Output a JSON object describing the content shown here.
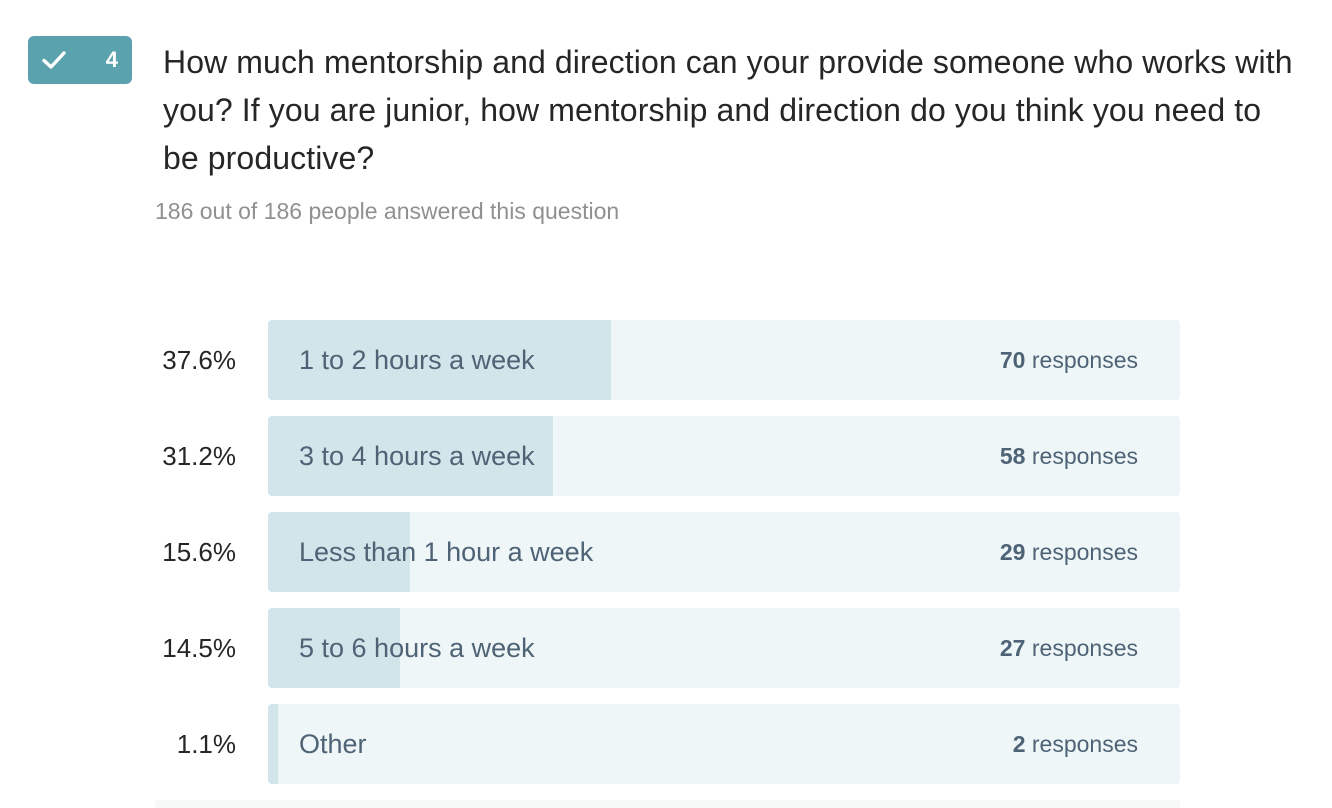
{
  "question": {
    "number": "4",
    "badge_icon": "check-icon",
    "badge_color": "#5aa2ad",
    "title": "How much mentorship and direction can your provide someone who works with you? If you are junior, how mentorship and direction do you think you need to be productive?",
    "answered_text": "186 out of 186 people answered this question"
  },
  "responses_word": "responses",
  "chart_data": {
    "type": "bar",
    "orientation": "horizontal",
    "categories": [
      "1 to 2 hours a week",
      "3 to 4 hours a week",
      "Less than 1 hour a week",
      "5 to 6 hours a week",
      "Other"
    ],
    "values": [
      70,
      58,
      29,
      27,
      2
    ],
    "percent_labels": [
      "37.6%",
      "31.2%",
      "15.6%",
      "14.5%",
      "1.1%"
    ],
    "percents": [
      37.6,
      31.2,
      15.6,
      14.5,
      1.1
    ],
    "count_labels": [
      "70",
      "58",
      "29",
      "27",
      "2"
    ],
    "xlim": [
      0,
      100
    ],
    "title": "",
    "xlabel": "",
    "ylabel": "",
    "colors": {
      "fill": "#d2e5ea",
      "track": "#eff6f8",
      "text": "#4e6375"
    }
  }
}
